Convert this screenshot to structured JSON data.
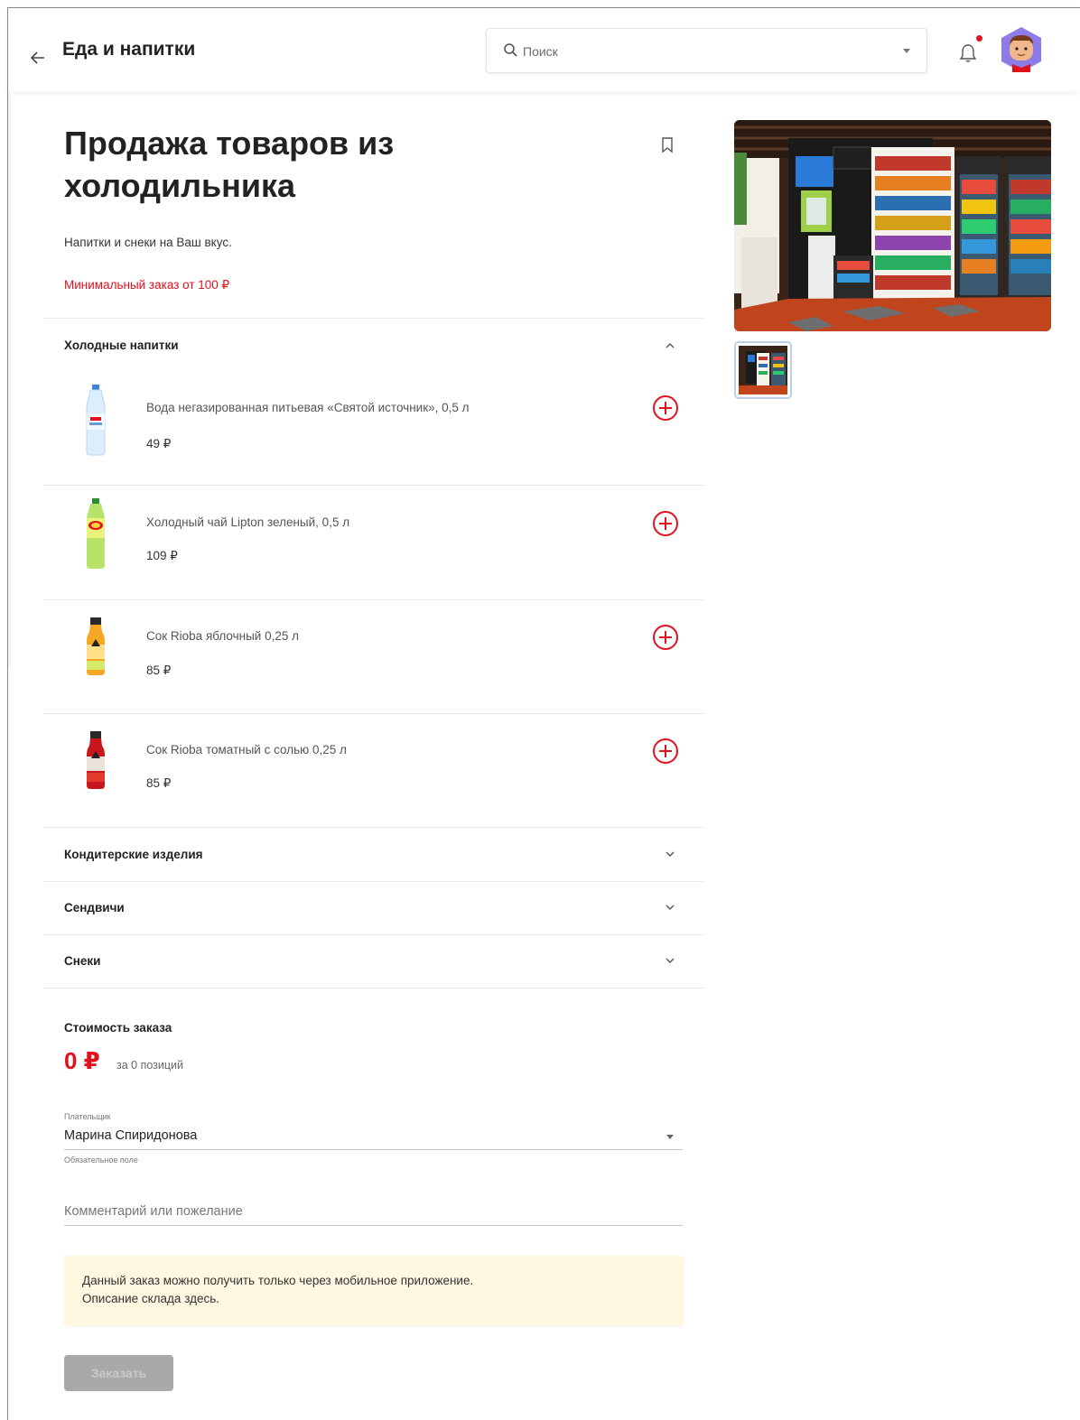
{
  "header": {
    "title": "Еда и напитки",
    "search_placeholder": "Поиск"
  },
  "service": {
    "title": "Продажа товаров из холодильника",
    "subtitle": "Напитки и снеки на Ваш вкус.",
    "min_order": "Минимальный заказ от 100 ₽"
  },
  "categories": [
    {
      "name": "Холодные напитки",
      "expanded": true,
      "items": [
        {
          "name": "Вода негазированная питьевая «Святой источник», 0,5 л",
          "price": "49 ₽"
        },
        {
          "name": "Холодный чай Lipton зеленый, 0,5 л",
          "price": "109 ₽"
        },
        {
          "name": "Сок Rioba яблочный 0,25 л",
          "price": "85 ₽"
        },
        {
          "name": "Сок Rioba томатный с солью 0,25 л",
          "price": "85 ₽"
        }
      ]
    },
    {
      "name": "Кондитерские изделия",
      "expanded": false
    },
    {
      "name": "Сендвичи",
      "expanded": false
    },
    {
      "name": "Снеки",
      "expanded": false
    }
  ],
  "order": {
    "total_label": "Стоимость заказа",
    "total_value": "0 ₽",
    "total_count": "за 0 позиций",
    "payer_label": "Плательщик",
    "payer_value": "Марина Спиридонова",
    "payer_hint": "Обязательное поле",
    "comment_placeholder": "Комментарий или пожелание",
    "notice_line1": "Данный заказ можно получить только через мобильное приложение.",
    "notice_line2": "Описание склада здесь.",
    "submit_label": "Заказать"
  },
  "colors": {
    "accent": "#e1111d",
    "notice_bg": "#fff7e0",
    "disabled_button": "#a9a9a9"
  },
  "icons": [
    "back-arrow-icon",
    "search-icon",
    "chevron-down-icon",
    "bell-icon",
    "avatar",
    "bookmark-icon",
    "chevron-up-icon",
    "add-circle-icon"
  ]
}
